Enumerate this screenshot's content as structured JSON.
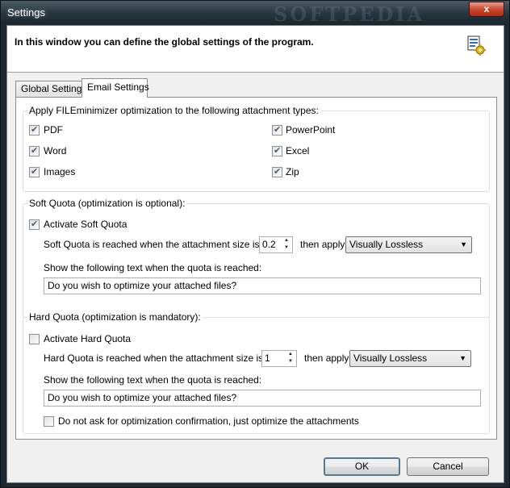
{
  "window": {
    "title": "Settings",
    "close_label": "x",
    "watermark": "SOFTPEDIA"
  },
  "header": {
    "text": "In this window you can define the global settings of the program.",
    "icon": "settings-gear-icon"
  },
  "tabs": [
    {
      "label": "Global Settings",
      "active": false
    },
    {
      "label": "Email Settings",
      "active": true
    }
  ],
  "attachments": {
    "label": "Apply FILEminimizer optimization to the following attachment types:",
    "types": [
      {
        "label": "PDF",
        "checked": true
      },
      {
        "label": "PowerPoint",
        "checked": true
      },
      {
        "label": "Word",
        "checked": true
      },
      {
        "label": "Excel",
        "checked": true
      },
      {
        "label": "Images",
        "checked": true
      },
      {
        "label": "Zip",
        "checked": true
      }
    ]
  },
  "soft_quota": {
    "label": "Soft Quota (optimization is optional):",
    "activate_label": "Activate Soft Quota",
    "activate_checked": true,
    "size_label": "Soft Quota is reached when the attachment size is MB:",
    "size_value": "0.2",
    "apply_label": "then apply:",
    "apply_value": "Visually Lossless",
    "text_label": "Show the following text when the quota is reached:",
    "text_value": "Do you wish to optimize your attached files?"
  },
  "hard_quota": {
    "label": "Hard Quota (optimization is mandatory):",
    "activate_label": "Activate Hard Quota",
    "activate_checked": false,
    "size_label": "Hard Quota is reached when the attachment size is MB:",
    "size_value": "1",
    "apply_label": "then apply:",
    "apply_value": "Visually Lossless",
    "text_label": "Show the following text when the quota is reached:",
    "text_value": "Do you wish to optimize your attached files?",
    "no_confirm_label": "Do not ask for optimization confirmation, just optimize the attachments",
    "no_confirm_checked": false
  },
  "buttons": {
    "ok": "OK",
    "cancel": "Cancel"
  }
}
